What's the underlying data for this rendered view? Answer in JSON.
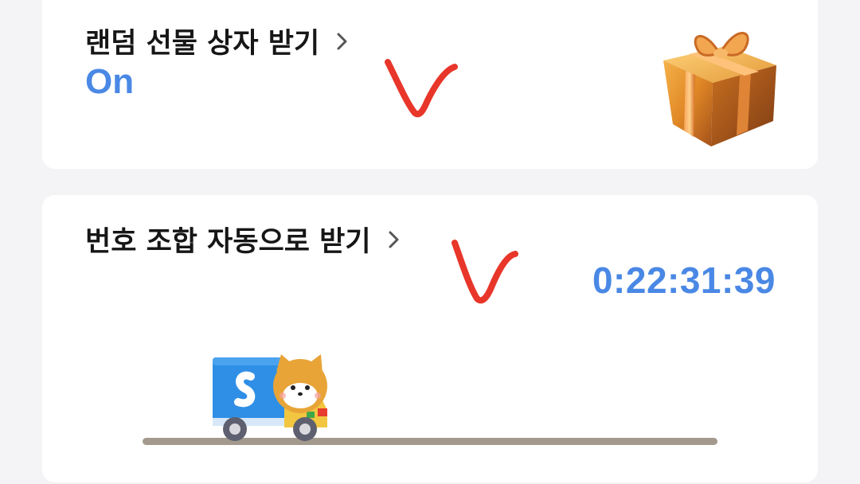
{
  "cards": [
    {
      "title": "랜덤 선물 상자 받기",
      "status": "On",
      "icon": "gift-box-icon"
    },
    {
      "title": "번호 조합 자동으로 받기",
      "timer": "0:22:31:39",
      "icon": "delivery-truck-icon"
    }
  ],
  "colors": {
    "accent": "#4a88e5",
    "title": "#161616",
    "check_mark": "#e8362a",
    "background": "#f4f4f6",
    "card": "#ffffff"
  }
}
